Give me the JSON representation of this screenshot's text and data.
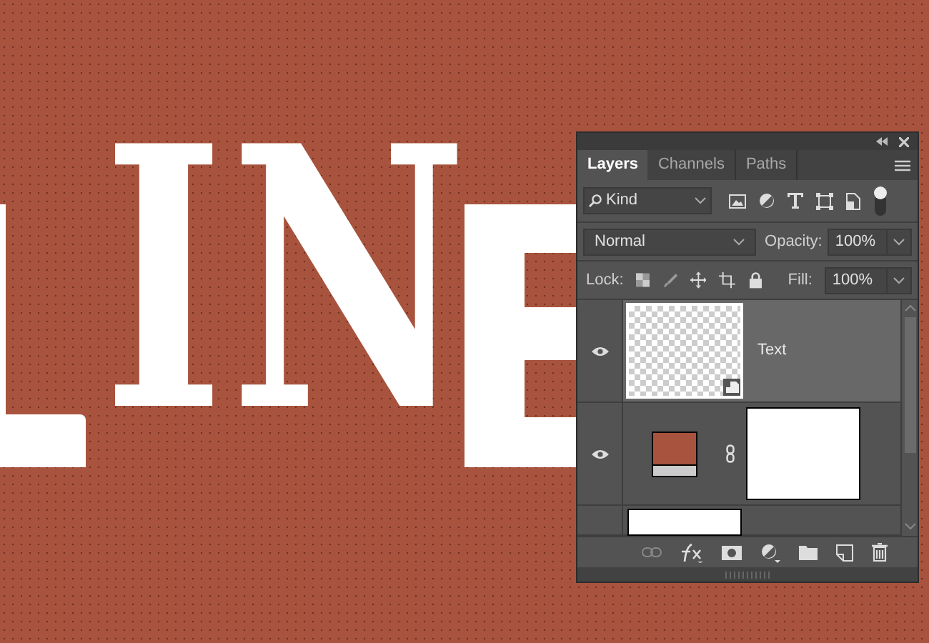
{
  "canvas": {
    "text": "IN"
  },
  "panel": {
    "tabs": [
      {
        "label": "Layers",
        "selected": true
      },
      {
        "label": "Channels",
        "selected": false
      },
      {
        "label": "Paths",
        "selected": false
      }
    ],
    "filter": {
      "value": "Kind"
    },
    "blend_mode": {
      "value": "Normal"
    },
    "opacity": {
      "label": "Opacity:",
      "value": "100%"
    },
    "lock": {
      "label": "Lock:"
    },
    "fill": {
      "label": "Fill:",
      "value": "100%"
    },
    "layers": [
      {
        "kind": "smart",
        "name": "Text",
        "selected": true,
        "visible": true
      },
      {
        "kind": "fill",
        "selected": false,
        "visible": true,
        "color": "#a8533d"
      },
      {
        "kind": "partial",
        "selected": false
      }
    ]
  }
}
